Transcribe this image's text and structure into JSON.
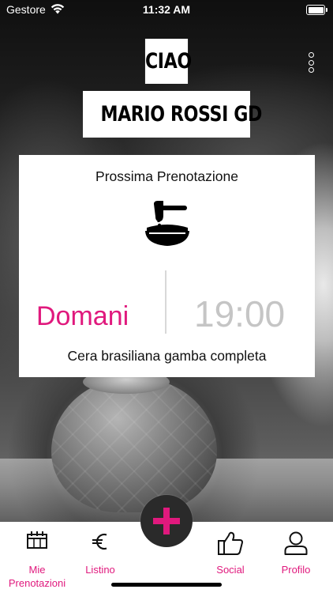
{
  "status_bar": {
    "carrier": "Gestore",
    "time": "11:32 AM"
  },
  "greeting": {
    "line1": "CIAO",
    "line2": "MARIO ROSSI GD"
  },
  "booking_card": {
    "title": "Prossima Prenotazione",
    "service_icon": "wax-pot-icon",
    "day": "Domani",
    "time": "19:00",
    "service": "Cera brasiliana gamba completa"
  },
  "tabbar": {
    "items": [
      {
        "label": "Mie Prenotazioni",
        "icon": "calendar-icon"
      },
      {
        "label": "Listino",
        "icon": "euro-icon"
      },
      {
        "label": "Social",
        "icon": "thumbs-up-icon"
      },
      {
        "label": "Profilo",
        "icon": "user-icon"
      }
    ],
    "fab_icon": "plus-icon"
  },
  "colors": {
    "accent": "#e0197d",
    "time_gray": "#c5c5c5",
    "fab_bg": "#2a2a2a"
  }
}
